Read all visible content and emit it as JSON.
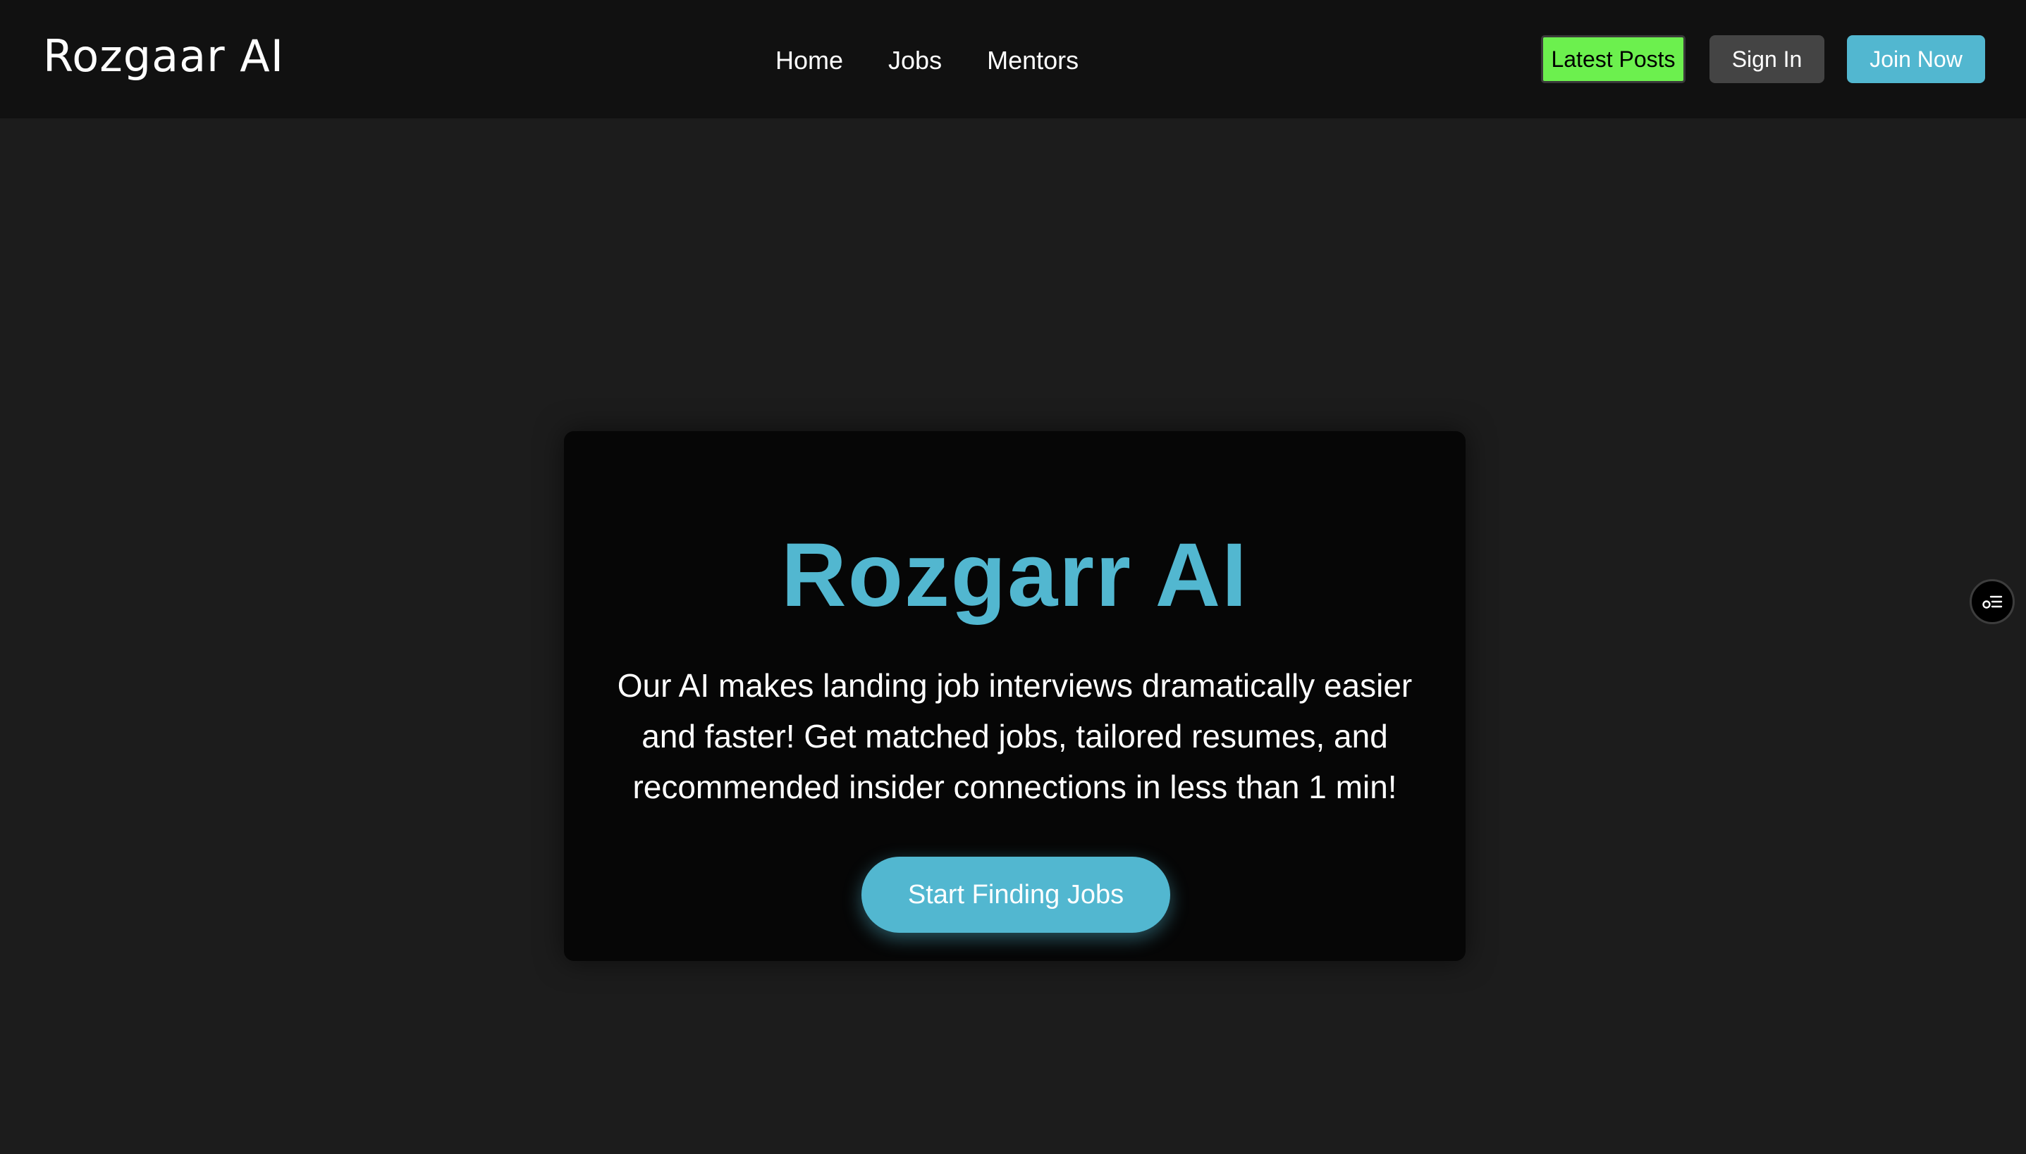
{
  "header": {
    "logo": "Rozgaar AI",
    "nav": [
      {
        "label": "Home"
      },
      {
        "label": "Jobs"
      },
      {
        "label": "Mentors"
      }
    ],
    "buttons": {
      "latest_posts": "Latest Posts",
      "sign_in": "Sign In",
      "join_now": "Join Now"
    }
  },
  "hero": {
    "title": "Rozgarr AI",
    "description": "Our AI makes landing job interviews dramatically easier and faster! Get matched jobs, tailored resumes, and recommended insider connections in less than 1 min!",
    "cta": "Start Finding Jobs"
  },
  "floating_widget": {
    "icon": "list-settings-icon"
  },
  "colors": {
    "page_background": "#1c1c1c",
    "header_background": "#111111",
    "card_background": "#060606",
    "accent": "#52b7d0",
    "latest_posts_green": "#6cf04e",
    "sign_in_gray": "#444444"
  }
}
